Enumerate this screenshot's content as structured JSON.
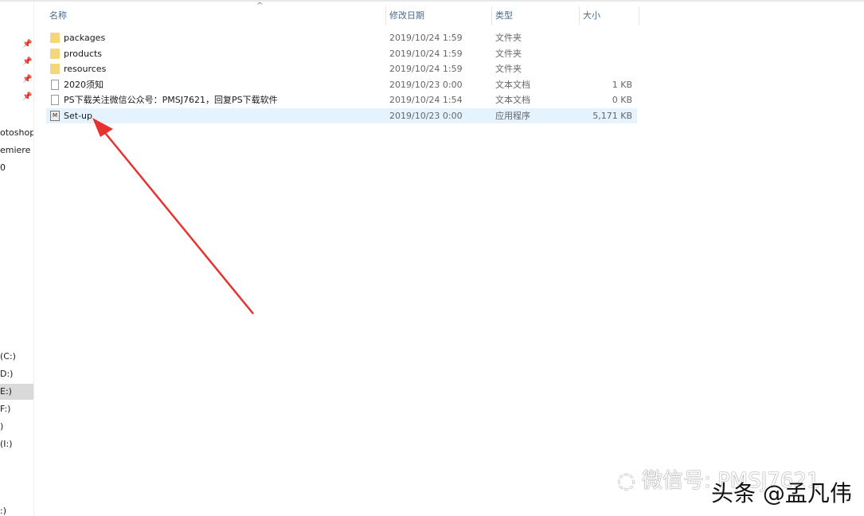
{
  "columns": {
    "name": "名称",
    "date": "修改日期",
    "type": "类型",
    "size": "大小"
  },
  "files": [
    {
      "name": "packages",
      "date": "2019/10/24 1:59",
      "type": "文件夹",
      "size": "",
      "icon": "folder-icon"
    },
    {
      "name": "products",
      "date": "2019/10/24 1:59",
      "type": "文件夹",
      "size": "",
      "icon": "folder-icon"
    },
    {
      "name": "resources",
      "date": "2019/10/24 1:59",
      "type": "文件夹",
      "size": "",
      "icon": "folder-icon"
    },
    {
      "name": "2020须知",
      "date": "2019/10/23 0:00",
      "type": "文本文档",
      "size": "1 KB",
      "icon": "text-file-icon"
    },
    {
      "name": "PS下载关注微信公众号：PMSJ7621，回复PS下载软件",
      "date": "2019/10/24 1:54",
      "type": "文本文档",
      "size": "0 KB",
      "icon": "text-file-icon"
    },
    {
      "name": "Set-up",
      "date": "2019/10/23 0:00",
      "type": "应用程序",
      "size": "5,171 KB",
      "icon": "adobe-app-icon"
    }
  ],
  "nav": [
    "otoshop",
    "emiere P",
    "0",
    "(C:)",
    "D:)",
    "E:)",
    "F:)",
    ")",
    "(I:)",
    ":)"
  ],
  "watermark": {
    "wechat": "微信号: PMSJ7621",
    "toutiao": "头条 @孟凡伟"
  },
  "arrow_color": "#e8322f"
}
